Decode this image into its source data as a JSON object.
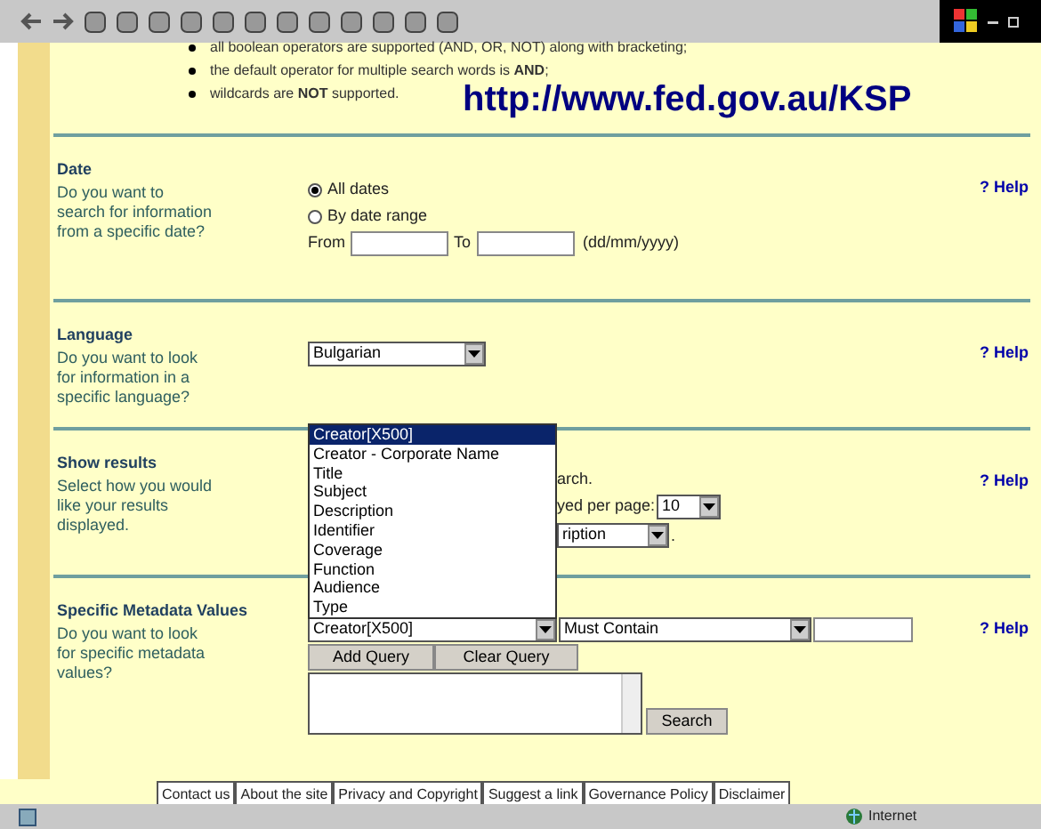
{
  "notes": [
    "all boolean operators are supported (AND, OR, NOT) along with bracketing;",
    "the default operator for multiple search words is **AND**;",
    "wildcards are **NOT** supported."
  ],
  "url_overlay": "http://www.fed.gov.au/KSP",
  "sections": [
    {
      "kind": "date",
      "title": "Date",
      "question": "Do you want to search for information from a specific date?",
      "help": "? Help",
      "options": [
        {
          "label": "All dates",
          "selected": true
        },
        {
          "label": "By date range",
          "selected": false
        }
      ],
      "from_label": "From",
      "to_label": "To",
      "format_hint": "(dd/mm/yyyy)"
    },
    {
      "kind": "language",
      "title": "Language",
      "question": "Do you want to look for information in a specific language?",
      "help": "? Help",
      "select_value": "Bulgarian"
    },
    {
      "kind": "results",
      "title": "Show results",
      "question": "Select how you would like your results displayed.",
      "help": "? Help",
      "line_1": "arch.",
      "line_2": "yed per page:",
      "per_page": "10",
      "sort_value": "ription",
      "end_mark": "."
    },
    {
      "kind": "metadata",
      "title": "Specific Metadata Values",
      "question": "Do you want to look for specific metadata values?",
      "help": "? Help",
      "field_select": "Creator[X500]",
      "operator_select": "Must Contain",
      "buttons": [
        "Add Query",
        "Clear Query"
      ],
      "search_button": "Search"
    }
  ],
  "dropdown": {
    "options": [
      {
        "label": "Creator[X500]",
        "selected": true
      },
      {
        "label": "Creator - Corporate Name",
        "selected": false
      },
      {
        "label": "Title",
        "selected": false
      },
      {
        "label": "Subject",
        "selected": false
      },
      {
        "label": "Description",
        "selected": false
      },
      {
        "label": "Identifier",
        "selected": false
      },
      {
        "label": "Coverage",
        "selected": false
      },
      {
        "label": "Function",
        "selected": false
      },
      {
        "label": "Audience",
        "selected": false
      },
      {
        "label": "Type",
        "selected": false
      }
    ]
  },
  "footer_links": [
    "Contact us",
    "About the site",
    "Privacy and Copyright",
    "Suggest a link",
    "Governance Policy",
    "Disclaimer"
  ],
  "status_bar": {
    "zone": "Internet"
  }
}
